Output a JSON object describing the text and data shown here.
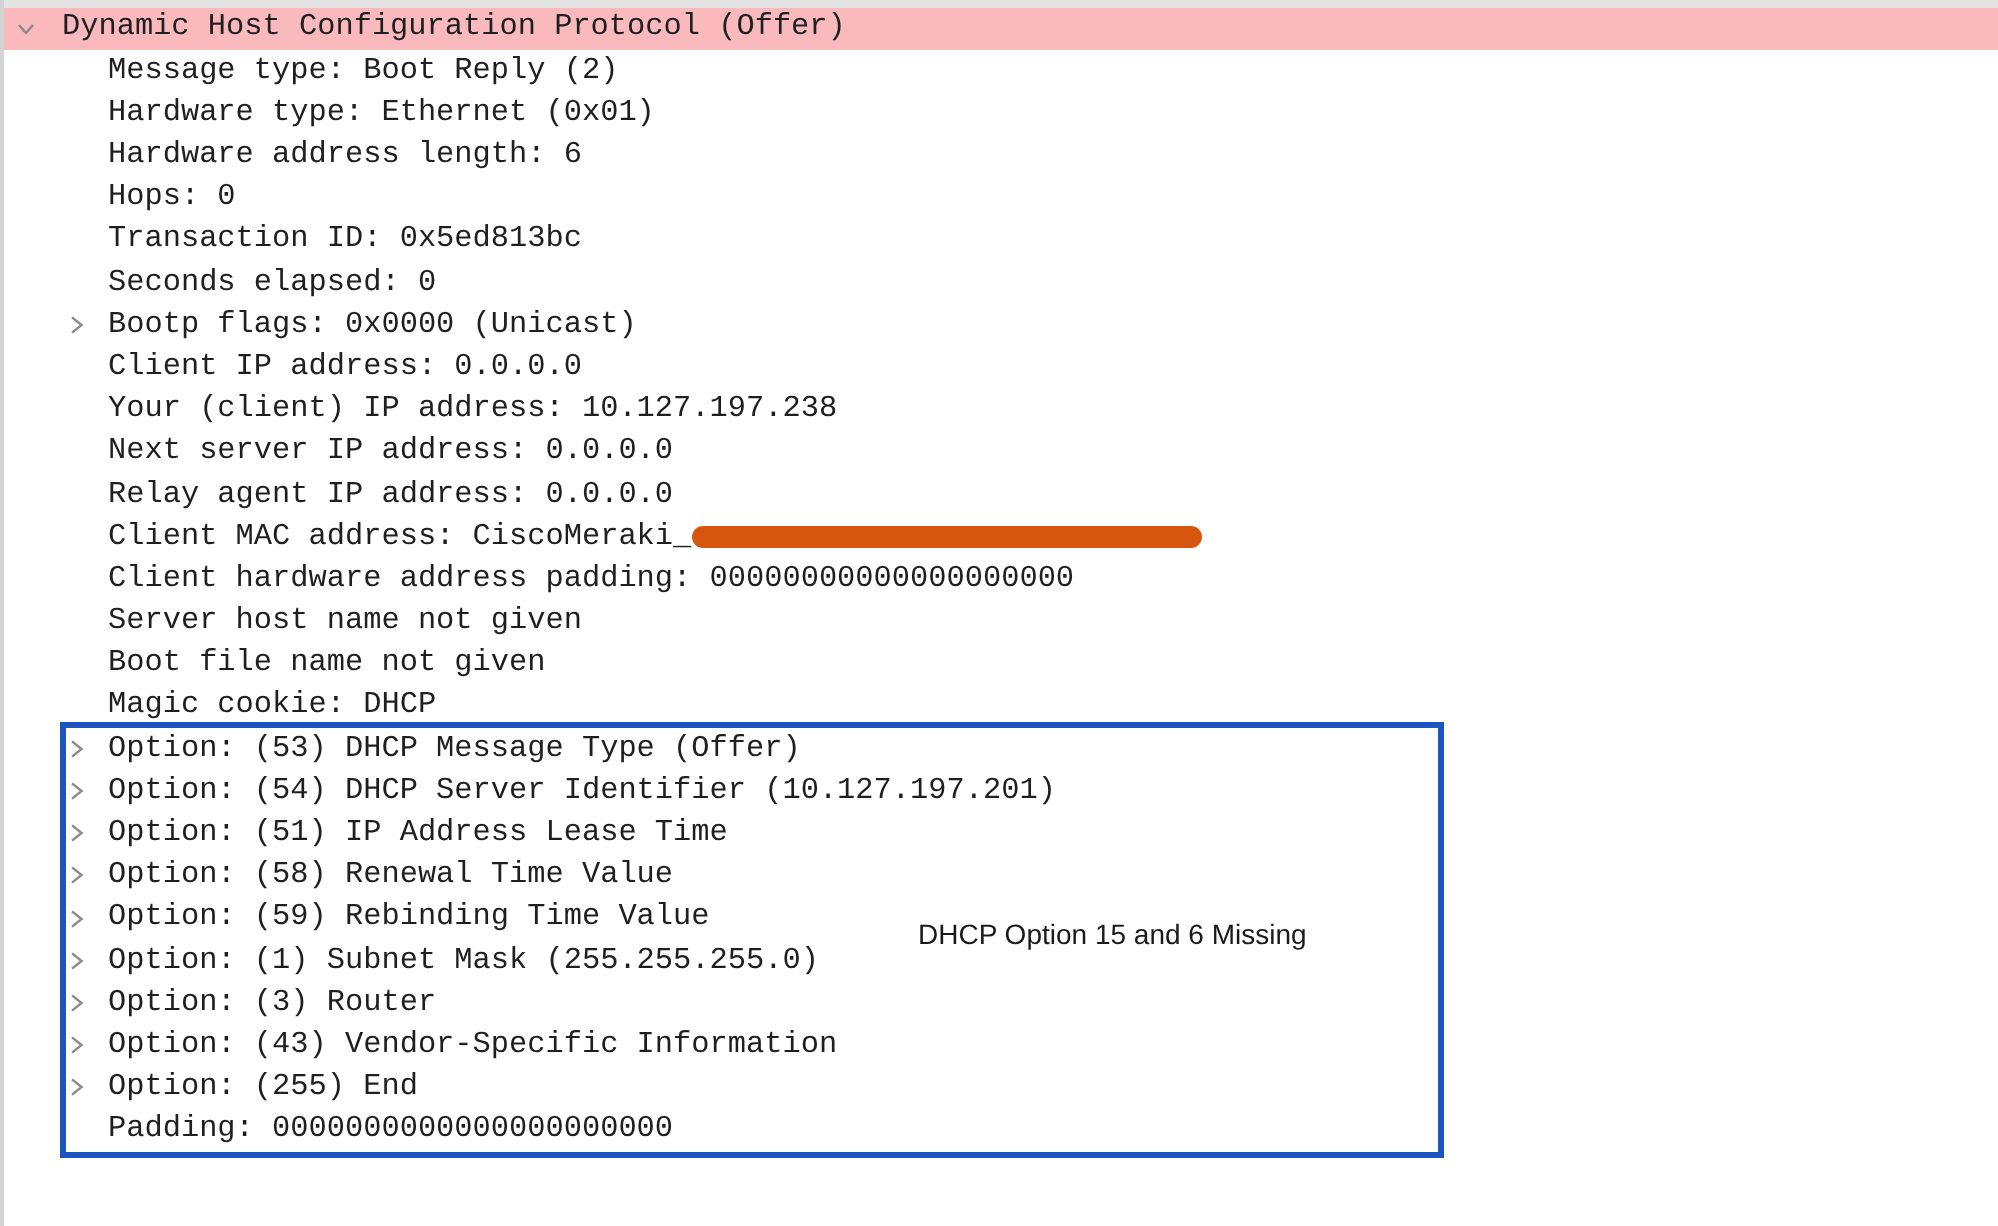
{
  "details_tree": {
    "label": "Dynamic Host Configuration Protocol (Offer)",
    "expanded": true,
    "highlighted": true,
    "children": [
      {
        "label": "Message type: Boot Reply (2)",
        "expandable": false,
        "redacted": false,
        "boxed": false
      },
      {
        "label": "Hardware type: Ethernet (0x01)",
        "expandable": false,
        "redacted": false,
        "boxed": false
      },
      {
        "label": "Hardware address length: 6",
        "expandable": false,
        "redacted": false,
        "boxed": false
      },
      {
        "label": "Hops: 0",
        "expandable": false,
        "redacted": false,
        "boxed": false
      },
      {
        "label": "Transaction ID: 0x5ed813bc",
        "expandable": false,
        "redacted": false,
        "boxed": false
      },
      {
        "label": "Seconds elapsed: 0",
        "expandable": false,
        "redacted": false,
        "boxed": false
      },
      {
        "label": "Bootp flags: 0x0000 (Unicast)",
        "expandable": true,
        "redacted": false,
        "boxed": false
      },
      {
        "label": "Client IP address: 0.0.0.0",
        "expandable": false,
        "redacted": false,
        "boxed": false
      },
      {
        "label": "Your (client) IP address: 10.127.197.238",
        "expandable": false,
        "redacted": false,
        "boxed": false
      },
      {
        "label": "Next server IP address: 0.0.0.0",
        "expandable": false,
        "redacted": false,
        "boxed": false
      },
      {
        "label": "Relay agent IP address: 0.0.0.0",
        "expandable": false,
        "redacted": false,
        "boxed": false
      },
      {
        "label": "Client MAC address: CiscoMeraki_",
        "expandable": false,
        "redacted": true,
        "boxed": false
      },
      {
        "label": "Client hardware address padding: 00000000000000000000",
        "expandable": false,
        "redacted": false,
        "boxed": false
      },
      {
        "label": "Server host name not given",
        "expandable": false,
        "redacted": false,
        "boxed": false
      },
      {
        "label": "Boot file name not given",
        "expandable": false,
        "redacted": false,
        "boxed": false
      },
      {
        "label": "Magic cookie: DHCP",
        "expandable": false,
        "redacted": false,
        "boxed": false
      },
      {
        "label": "Option: (53) DHCP Message Type (Offer)",
        "expandable": true,
        "redacted": false,
        "boxed": true
      },
      {
        "label": "Option: (54) DHCP Server Identifier (10.127.197.201)",
        "expandable": true,
        "redacted": false,
        "boxed": true
      },
      {
        "label": "Option: (51) IP Address Lease Time",
        "expandable": true,
        "redacted": false,
        "boxed": true
      },
      {
        "label": "Option: (58) Renewal Time Value",
        "expandable": true,
        "redacted": false,
        "boxed": true
      },
      {
        "label": "Option: (59) Rebinding Time Value",
        "expandable": true,
        "redacted": false,
        "boxed": true
      },
      {
        "label": "Option: (1) Subnet Mask (255.255.255.0)",
        "expandable": true,
        "redacted": false,
        "boxed": true
      },
      {
        "label": "Option: (3) Router",
        "expandable": true,
        "redacted": false,
        "boxed": true
      },
      {
        "label": "Option: (43) Vendor-Specific Information",
        "expandable": true,
        "redacted": false,
        "boxed": true
      },
      {
        "label": "Option: (255) End",
        "expandable": true,
        "redacted": false,
        "boxed": true
      },
      {
        "label": "Padding: 0000000000000000000000",
        "expandable": false,
        "redacted": false,
        "boxed": true
      }
    ]
  },
  "annotation": {
    "note": "DHCP Option 15 and 6 Missing"
  }
}
